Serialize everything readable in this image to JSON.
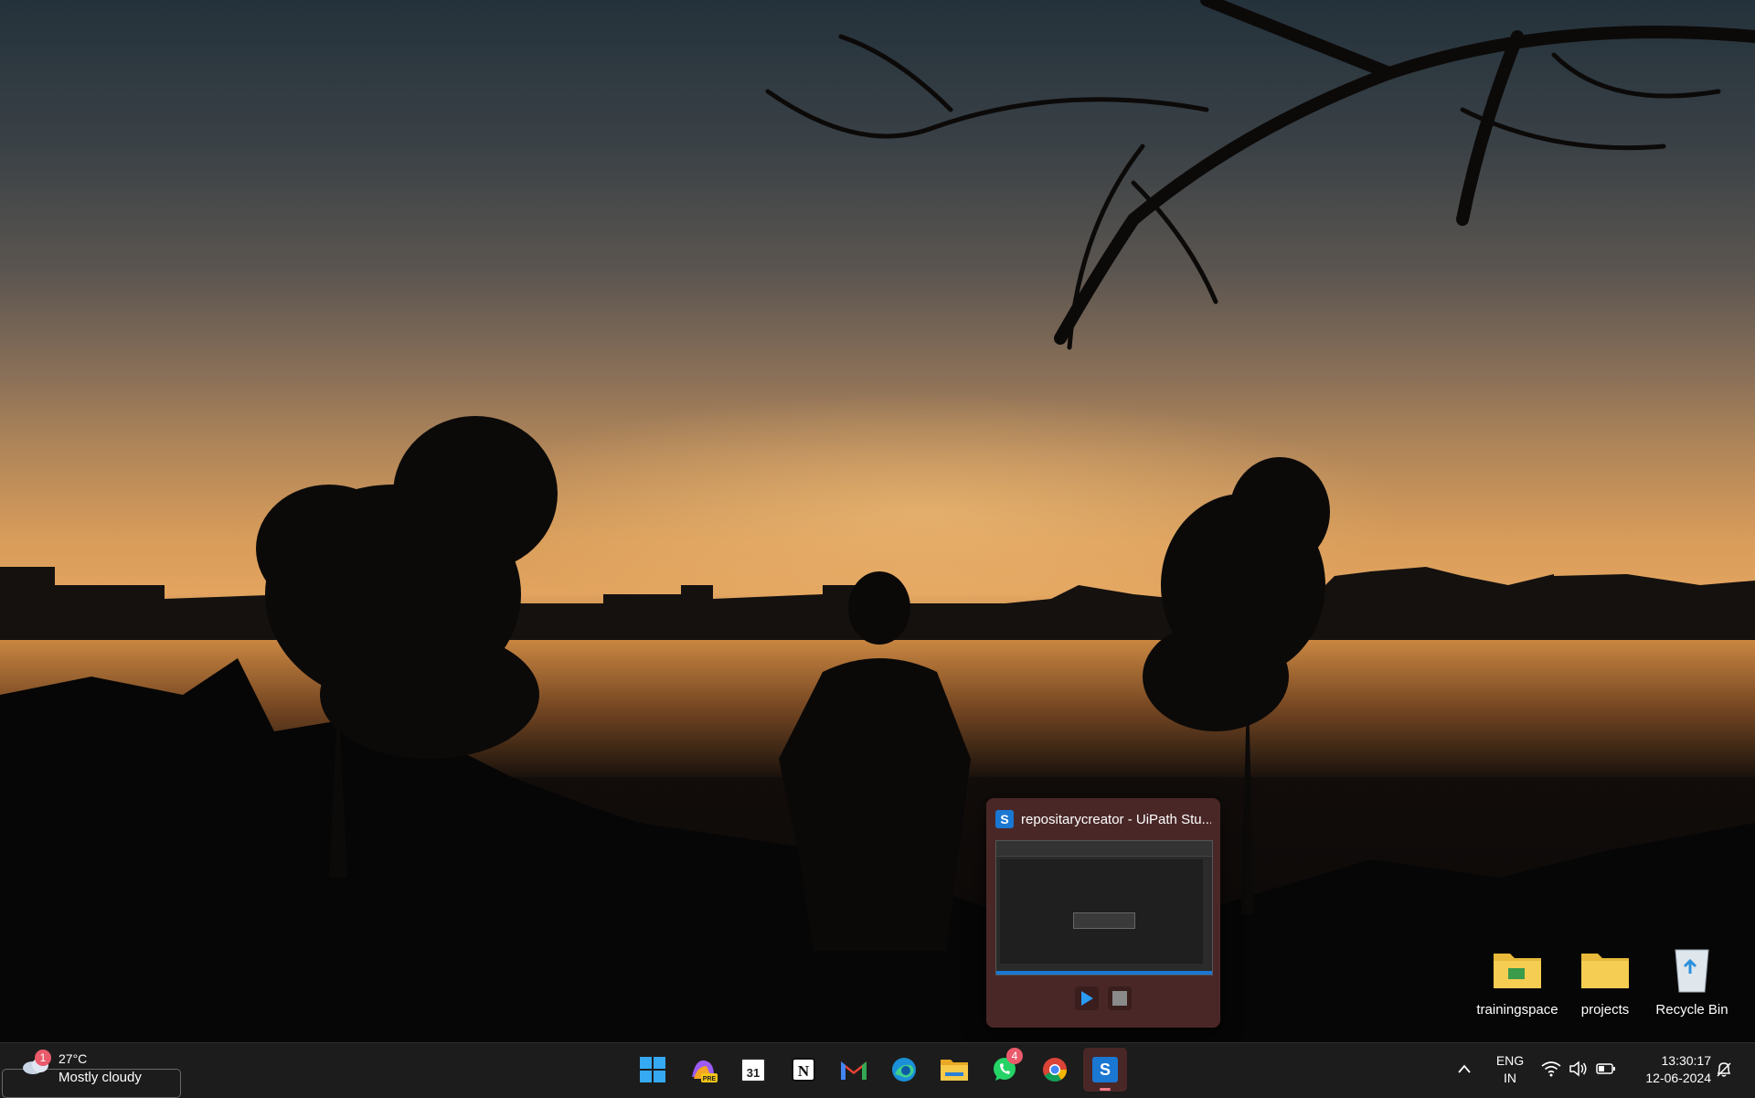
{
  "desktop": {
    "icons": [
      {
        "label": "trainingspace",
        "icon": "folder-icon"
      },
      {
        "label": "projects",
        "icon": "folder-icon"
      },
      {
        "label": "Recycle Bin",
        "icon": "recycle-bin-icon"
      }
    ]
  },
  "preview": {
    "title": "repositarycreator - UiPath Stu...",
    "app_icon": "uipath-icon",
    "logo_letter": "S",
    "controls": [
      "play-icon",
      "stop-icon"
    ]
  },
  "taskbar": {
    "weather": {
      "temp": "27°C",
      "condition": "Mostly cloudy",
      "badge": "1",
      "icon": "cloud-icon"
    },
    "apps": [
      {
        "name": "Start",
        "icon": "windows-start-icon"
      },
      {
        "name": "Copilot",
        "icon": "copilot-icon",
        "tag": "PRE"
      },
      {
        "name": "Calendar",
        "icon": "calendar-icon",
        "text": "31"
      },
      {
        "name": "Notion",
        "icon": "notion-icon",
        "text": "N"
      },
      {
        "name": "Gmail",
        "icon": "gmail-icon"
      },
      {
        "name": "Edge",
        "icon": "edge-icon"
      },
      {
        "name": "File Explorer",
        "icon": "file-explorer-icon"
      },
      {
        "name": "WhatsApp",
        "icon": "whatsapp-icon",
        "badge": "4"
      },
      {
        "name": "Chrome",
        "icon": "chrome-icon"
      },
      {
        "name": "UiPath Studio",
        "icon": "uipath-icon",
        "text": "S",
        "active": true
      }
    ],
    "tray": {
      "lang_line1": "ENG",
      "lang_line2": "IN",
      "time": "13:30:17",
      "date": "12-06-2024"
    }
  },
  "colors": {
    "taskbar": "#1c1c1c",
    "accent": "#1a77d2",
    "badge": "#e95b6b",
    "preview_bg": "#4a2727"
  }
}
